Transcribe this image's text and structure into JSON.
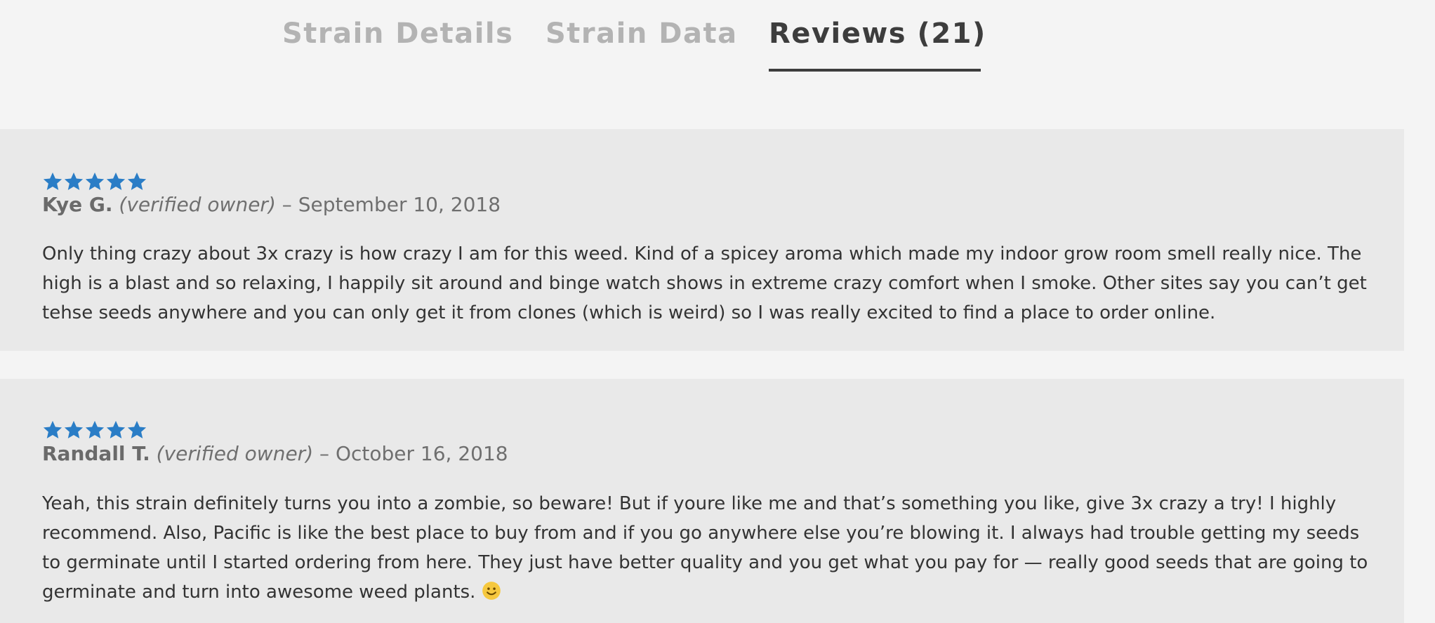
{
  "tabs": [
    {
      "label": "Strain Details",
      "active": false
    },
    {
      "label": "Strain Data",
      "active": false
    },
    {
      "label": "Reviews (21)",
      "active": true
    }
  ],
  "colors": {
    "star": "#2a7dc6",
    "active_tab": "#3d3d3d",
    "inactive_tab": "#b3b3b3",
    "review_bg": "#e9e9e9",
    "page_bg": "#f4f4f4"
  },
  "reviews": [
    {
      "rating": 5,
      "rating_max": 5,
      "author": "Kye G.",
      "verified": "(verified owner)",
      "separator": "–",
      "date": "September 10, 2018",
      "text": "Only thing crazy about 3x crazy is how crazy I am for this weed. Kind of a spicey aroma which made my indoor grow room smell really nice. The high is a blast and so relaxing, I happily sit around and binge watch shows in extreme crazy comfort when I smoke. Other sites say you can’t get tehse seeds anywhere and you can only get it from clones (which is weird) so I was really excited to find a place to order online."
    },
    {
      "rating": 5,
      "rating_max": 5,
      "author": "Randall T.",
      "verified": "(verified owner)",
      "separator": "–",
      "date": "October 16, 2018",
      "text": "Yeah, this strain definitely turns you into a zombie, so beware! But if youre like me and that’s something you like, give 3x crazy a try! I highly recommend. Also, Pacific is like the best place to buy from and if you go anywhere else you’re blowing it. I always had trouble getting my seeds to germinate until I started ordering from here. They just have better quality and you get what you pay for — really good seeds that are going to germinate and turn into awesome weed plants.",
      "trailing_icon": "smiley-icon"
    }
  ]
}
